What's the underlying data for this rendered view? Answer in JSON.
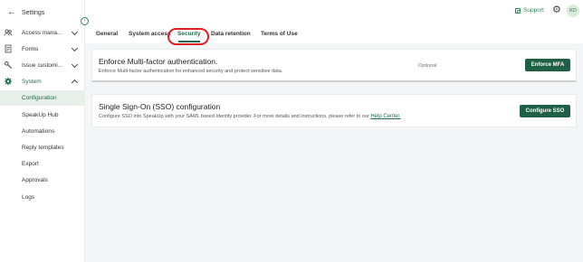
{
  "sidebar": {
    "back_label": "Settings",
    "collapse_icon": "chevron-left-circle-icon",
    "items": [
      {
        "label": "Access mana...",
        "icon": "users-icon",
        "expanded": false
      },
      {
        "label": "Forms",
        "icon": "forms-icon",
        "expanded": false
      },
      {
        "label": "Issue customi...",
        "icon": "wrench-icon",
        "expanded": false
      },
      {
        "label": "System",
        "icon": "gear-icon",
        "expanded": true
      }
    ],
    "sub_items": [
      {
        "label": "Configuration",
        "selected": true
      },
      {
        "label": "SpeakUp Hub"
      },
      {
        "label": "Automations"
      },
      {
        "label": "Reply templates"
      },
      {
        "label": "Export"
      },
      {
        "label": "Approvals"
      },
      {
        "label": "Logs"
      }
    ]
  },
  "header": {
    "support_label": "Support",
    "avatar_initials": "KD"
  },
  "tabs": [
    {
      "label": "General"
    },
    {
      "label": "System access"
    },
    {
      "label": "Security",
      "active": true
    },
    {
      "label": "Data retention"
    },
    {
      "label": "Terms of Use"
    }
  ],
  "cards": {
    "mfa": {
      "title": "Enforce Multi-factor authentication.",
      "description": "Enforce Multi-factor authentication for enhanced security and protect sensitive data.",
      "status": "Optional",
      "button": "Enforce MFA"
    },
    "sso": {
      "title": "Single Sign-On (SSO) configuration",
      "description": "Configure SSO into SpeakUp with your SAML based Identity provider. For more details and instructions, please refer to our",
      "link": "Help Center.",
      "button": "Configure SSO"
    }
  },
  "colors": {
    "accent": "#1f6b4a",
    "button": "#1f5f46",
    "highlight": "#e02020"
  }
}
